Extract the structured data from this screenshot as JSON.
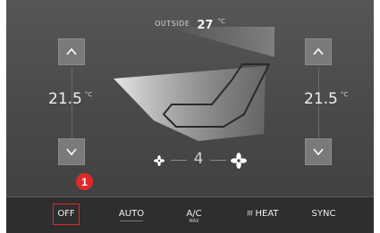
{
  "outside": {
    "label": "OUTSIDE",
    "value": "27",
    "unit": "°C"
  },
  "left_zone": {
    "temp": "21.5",
    "unit": "°C",
    "up_icon": "chevron-up-icon",
    "down_icon": "chevron-down-icon"
  },
  "right_zone": {
    "temp": "21.5",
    "unit": "°C",
    "up_icon": "chevron-up-icon",
    "down_icon": "chevron-down-icon"
  },
  "fan": {
    "speed": "4",
    "low_icon": "fan-small-icon",
    "high_icon": "fan-large-icon"
  },
  "seat_icon": "seat-airflow-icon",
  "bottom_bar": {
    "off": "OFF",
    "auto": "AUTO",
    "ac": "A/C",
    "ac_sub": "MAX",
    "heat": "HEAT",
    "heat_icon": "heated-windshield-icon",
    "sync": "SYNC"
  },
  "callout": {
    "number": "1"
  },
  "colors": {
    "highlight": "#e0282b",
    "background": "#4a4a4a"
  }
}
